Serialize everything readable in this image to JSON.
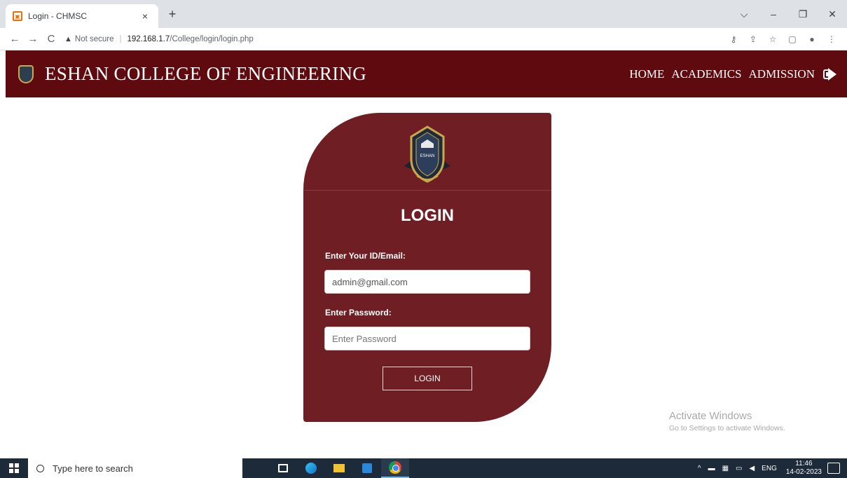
{
  "browser": {
    "tab_title": "Login - CHMSC",
    "tab_close": "×",
    "new_tab": "+",
    "window_controls": {
      "dropdown": "⌵",
      "minimize": "–",
      "restore": "❐",
      "close": "✕"
    },
    "nav": {
      "back": "←",
      "forward": "→",
      "reload": "C"
    },
    "security_label": "Not secure",
    "url_host": "192.168.1.7",
    "url_path": "/College/login/login.php",
    "toolbar_icons": [
      "key-icon",
      "share-icon",
      "star-icon",
      "sidepanel-icon",
      "profile-icon",
      "menu-icon"
    ]
  },
  "site": {
    "brand": "ESHAN COLLEGE OF ENGINEERING",
    "nav": [
      "HOME",
      "ACADEMICS",
      "ADMISSION"
    ],
    "logout_icon": "sign-out-icon",
    "header_color": "#5e0a0f"
  },
  "login": {
    "crest_text": "ESHAN",
    "title": "LOGIN",
    "id_label": "Enter Your ID/Email:",
    "id_value": "admin@gmail.com",
    "password_label": "Enter Password:",
    "password_placeholder": "Enter Password",
    "button": "LOGIN",
    "card_color": "#6f1e24"
  },
  "watermark": {
    "line1": "Activate Windows",
    "line2": "Go to Settings to activate Windows."
  },
  "taskbar": {
    "search_placeholder": "Type here to search",
    "lang": "ENG",
    "time": "11:46",
    "date": "14-02-2023",
    "tray_up": "^"
  }
}
